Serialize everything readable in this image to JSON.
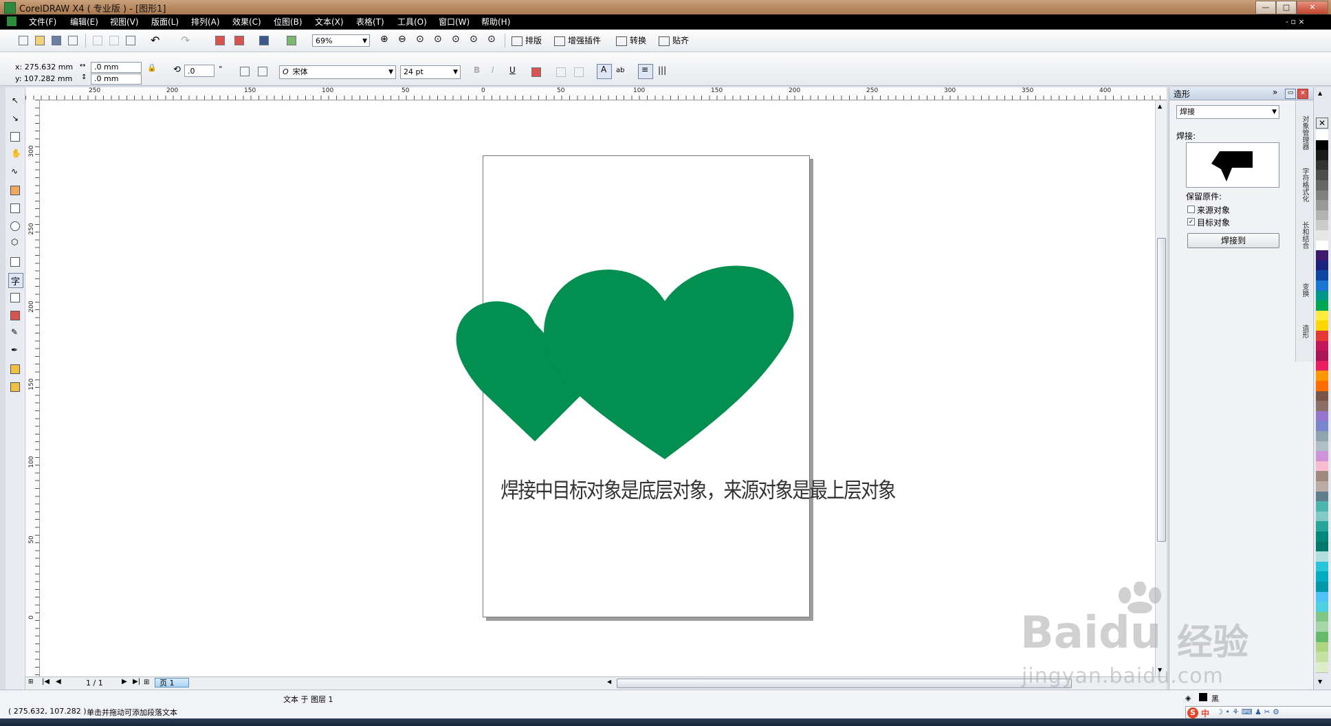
{
  "window": {
    "title": "CorelDRAW X4 ( 专业版 ) - [图形1]",
    "minimize": "—",
    "maximize": "□",
    "close": "✕"
  },
  "menu": [
    "文件(F)",
    "编辑(E)",
    "视图(V)",
    "版面(L)",
    "排列(A)",
    "效果(C)",
    "位图(B)",
    "文本(X)",
    "表格(T)",
    "工具(O)",
    "窗口(W)",
    "帮助(H)"
  ],
  "toolbar": {
    "zoom": "69%",
    "plugins": [
      "排版",
      "增强插件",
      "转换",
      "贴齐"
    ]
  },
  "propertybar": {
    "x": "x: 275.632 mm",
    "y": "y: 107.282 mm",
    "w": ".0 mm",
    "h": ".0 mm",
    "angle": ".0",
    "degree": "°",
    "font": "宋体",
    "font_size": "24 pt"
  },
  "ruler": {
    "h_labels": [
      "250",
      "200",
      "150",
      "100",
      "50",
      "0",
      "50",
      "100",
      "150",
      "200",
      "250",
      "300",
      "350",
      "400"
    ],
    "v_labels": [
      "300",
      "250",
      "200",
      "150",
      "100",
      "50",
      "0"
    ]
  },
  "canvas": {
    "caption": "焊接中目标对象是底层对象，来源对象是最上层对象",
    "heart_color": "#038f4f"
  },
  "navigation": {
    "page_count": "1 / 1",
    "page_tab": "页 1"
  },
  "docker": {
    "title": "造形",
    "mode": "焊接",
    "section_label": "焊接:",
    "keep_originals": "保留原件:",
    "source_object": "来源对象",
    "target_object": "目标对象",
    "source_checked": false,
    "target_checked": true,
    "weld_button": "焊接到",
    "tabs": [
      "对象管理器",
      "字符格式化",
      "长和结合",
      "变换",
      "造形"
    ]
  },
  "palette": [
    "#ffffff",
    "#000000",
    "#1a1a1a",
    "#333333",
    "#4d4d4d",
    "#666666",
    "#808080",
    "#999999",
    "#b3b3b3",
    "#cccccc",
    "#e6e6e6",
    "#ffffff",
    "#3d1a6e",
    "#1a237e",
    "#0d47a1",
    "#1976d2",
    "#009688",
    "#00a651",
    "#ffeb3b",
    "#ffd600",
    "#e53935",
    "#c2185b",
    "#ad1457",
    "#e91e63",
    "#ff9800",
    "#ff6d00",
    "#795548",
    "#8d6e63",
    "#9575cd",
    "#7986cb",
    "#90a4ae",
    "#b0bec5",
    "#ce93d8",
    "#f8bbd0",
    "#a1887f",
    "#bcaaa4",
    "#607d8b",
    "#4db6ac",
    "#80cbc4",
    "#26a69a",
    "#00897b",
    "#00796b",
    "#b2dfdb",
    "#26c6da",
    "#00acc1",
    "#0097a7",
    "#4fc3f7",
    "#4dd0e1",
    "#81c784",
    "#a5d6a7",
    "#66bb6a",
    "#aed581",
    "#c5e1a5",
    "#dcedc8"
  ],
  "status": {
    "coords": "( 275.632, 107.282 )",
    "hint": "单击并拖动可添加段落文本",
    "layer": "文本 于 图层 1",
    "fill": "黑"
  },
  "ime": {
    "logo": "S",
    "mode": "中"
  },
  "watermark": {
    "brand": "Bai",
    "brand_du": "du",
    "cn": "经验",
    "url": "jingyan.baidu.com"
  }
}
